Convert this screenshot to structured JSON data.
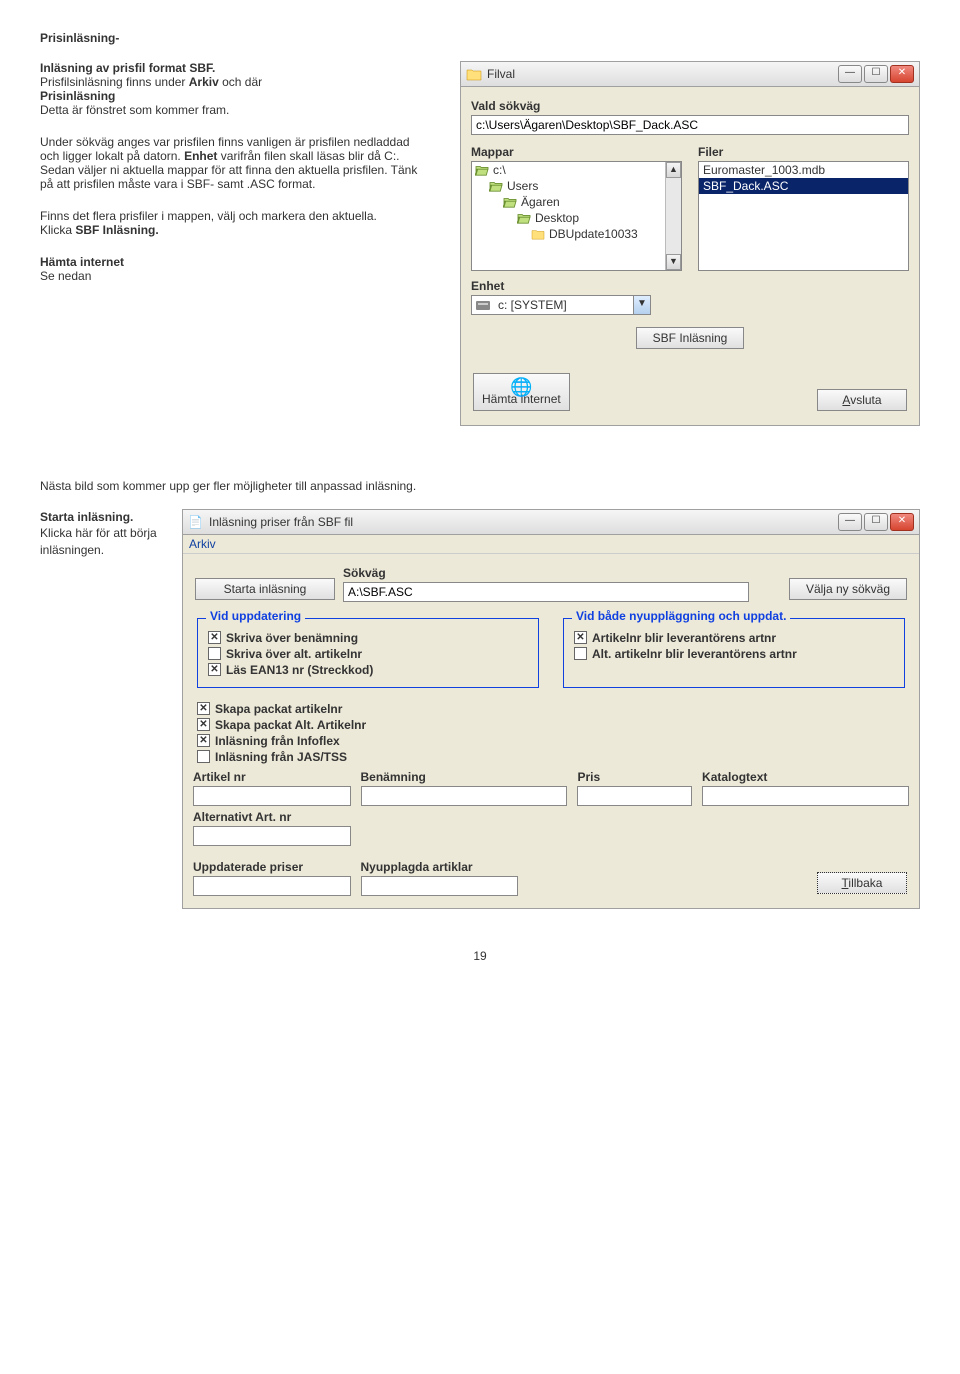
{
  "doc": {
    "title": "Prisinläsning-",
    "p1a": "Inläsning av prisfil format SBF.",
    "p1b": "Prisfilsinläsning finns under ",
    "p1b_bold": "Arkiv",
    "p1c": " och där ",
    "p1d": "Prisinläsning",
    "p1e": "Detta är fönstret som kommer fram.",
    "p2a": "Under sökväg anges var prisfilen finns vanligen är prisfilen nedladdad och ligger lokalt på datorn. ",
    "p2b_bold": "Enhet",
    "p2b": " varifrån filen skall läsas blir då C:.",
    "p2c": "Sedan väljer ni aktuella mappar för att finna den aktuella prisfilen. Tänk på att prisfilen måste vara i SBF- samt .ASC format.",
    "p3a": "Finns det flera prisfiler i mappen, välj och markera den aktuella.",
    "p3b": "Klicka ",
    "p3b_bold": "SBF Inläsning.",
    "p4a_bold": "Hämta internet",
    "p4b": "Se nedan",
    "mid": "Nästa bild som kommer upp ger fler möjligheter till anpassad inläsning.",
    "p5a_bold": "Starta inläsning.",
    "p5b": "Klicka här för att börja inläsningen.",
    "page_num": "19"
  },
  "win1": {
    "title": "Filval",
    "vald_sokvag_lbl": "Vald sökväg",
    "vald_sokvag_val": "c:\\Users\\Ägaren\\Desktop\\SBF_Dack.ASC",
    "mappar_lbl": "Mappar",
    "filer_lbl": "Filer",
    "folders": [
      {
        "label": "c:\\",
        "indent": "indent0",
        "type": "open"
      },
      {
        "label": "Users",
        "indent": "indent1",
        "type": "open"
      },
      {
        "label": "Ägaren",
        "indent": "indent2",
        "type": "open"
      },
      {
        "label": "Desktop",
        "indent": "indent3",
        "type": "open_sel"
      },
      {
        "label": "DBUpdate10033",
        "indent": "indent4",
        "type": "closed"
      }
    ],
    "files": [
      {
        "label": "Euromaster_1003.mdb",
        "sel": false
      },
      {
        "label": "SBF_Dack.ASC",
        "sel": true
      }
    ],
    "enhet_lbl": "Enhet",
    "enhet_val": "c: [SYSTEM]",
    "btn_sbf": "SBF Inläsning",
    "btn_hamta": "Hämta internet",
    "btn_avsluta": "Avsluta"
  },
  "win2": {
    "title": "Inläsning priser från SBF fil",
    "menu_arkiv": "Arkiv",
    "btn_starta": "Starta inläsning",
    "lbl_sokvag": "Sökväg",
    "sokvag_val": "A:\\SBF.ASC",
    "btn_valja": "Välja ny sökväg",
    "gb1_title": "Vid uppdatering",
    "gb1_c1": "Skriva över benämning",
    "gb1_c2": "Skriva över alt. artikelnr",
    "gb1_c3": "Läs EAN13 nr (Streckkod)",
    "gb2_title": "Vid både nyuppläggning och uppdat.",
    "gb2_c1": "Artikelnr blir leverantörens artnr",
    "gb2_c2": "Alt. artikelnr blir leverantörens artnr",
    "mid_c1": "Skapa packat artikelnr",
    "mid_c2": "Skapa packat Alt. Artikelnr",
    "mid_c3": "Inläsning från Infoflex",
    "mid_c4": "Inläsning från JAS/TSS",
    "f_art": "Artikel nr",
    "f_ben": "Benämning",
    "f_pris": "Pris",
    "f_kat": "Katalogtext",
    "f_alt": "Alternativt Art. nr",
    "f_upd": "Uppdaterade priser",
    "f_ny": "Nyupplagda artiklar",
    "btn_tillbaka": "Tillbaka"
  }
}
